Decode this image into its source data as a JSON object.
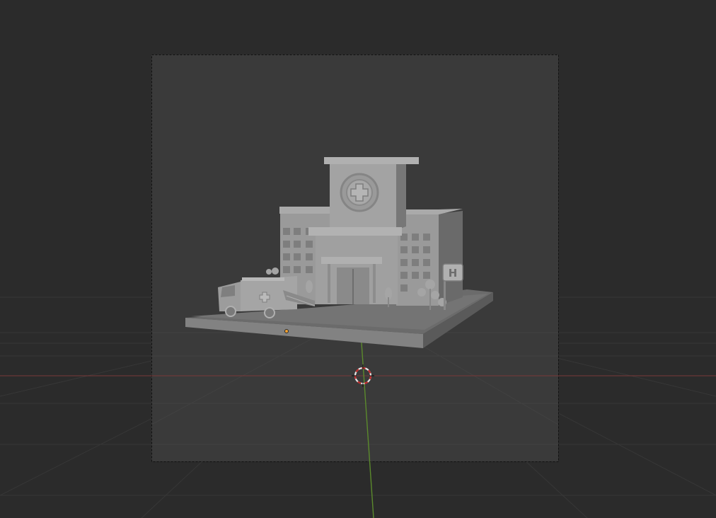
{
  "viewport": {
    "background_color": "#2b2b2b",
    "grid_color": "#373737",
    "x_axis_color": "#8a3a3a",
    "y_axis_color": "#5a8a2a",
    "cursor_colors": [
      "#e6e6e6",
      "#c02a2a"
    ],
    "origin_color": "#f0a030"
  },
  "scene": {
    "model_color": "#8c8c8c",
    "sign_letter": "H"
  }
}
